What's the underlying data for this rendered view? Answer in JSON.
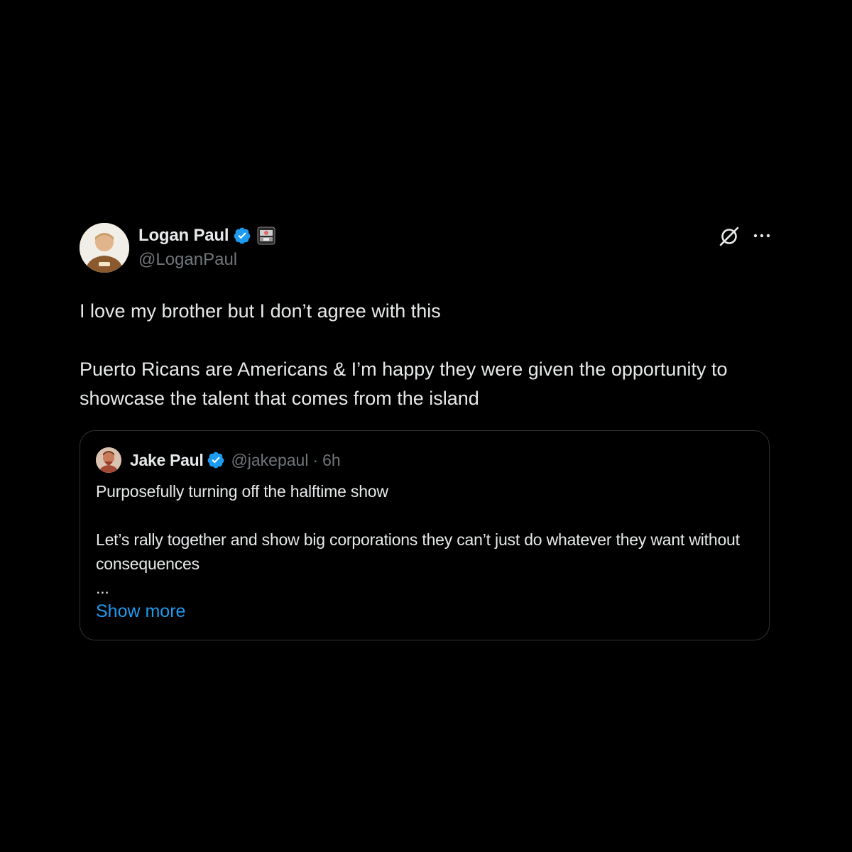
{
  "tweet": {
    "author": {
      "display_name": "Logan Paul",
      "handle": "@LoganPaul",
      "verified": true
    },
    "paragraphs": [
      "I love my brother but I don’t agree with this",
      "Puerto Ricans are Americans & I’m happy they were given the opportunity to showcase the talent that comes from the island"
    ],
    "icons": {
      "verified": "verified-badge-icon",
      "flair": "affiliate-badge-icon",
      "grok": "grok-icon",
      "more": "more-options-icon"
    }
  },
  "quote": {
    "author": {
      "display_name": "Jake Paul",
      "handle": "@jakepaul",
      "separator": "·",
      "time": "6h",
      "verified": true
    },
    "paragraphs": [
      "Purposefully turning off the halftime show",
      "Let’s rally together and show big corporations they can’t just do whatever they want without consequences"
    ],
    "ellipsis": "...",
    "show_more_label": "Show more"
  },
  "colors": {
    "background": "#000000",
    "text_primary": "#e7e9ea",
    "text_secondary": "#71767b",
    "accent": "#1d9bf0",
    "border": "#2f3336"
  }
}
